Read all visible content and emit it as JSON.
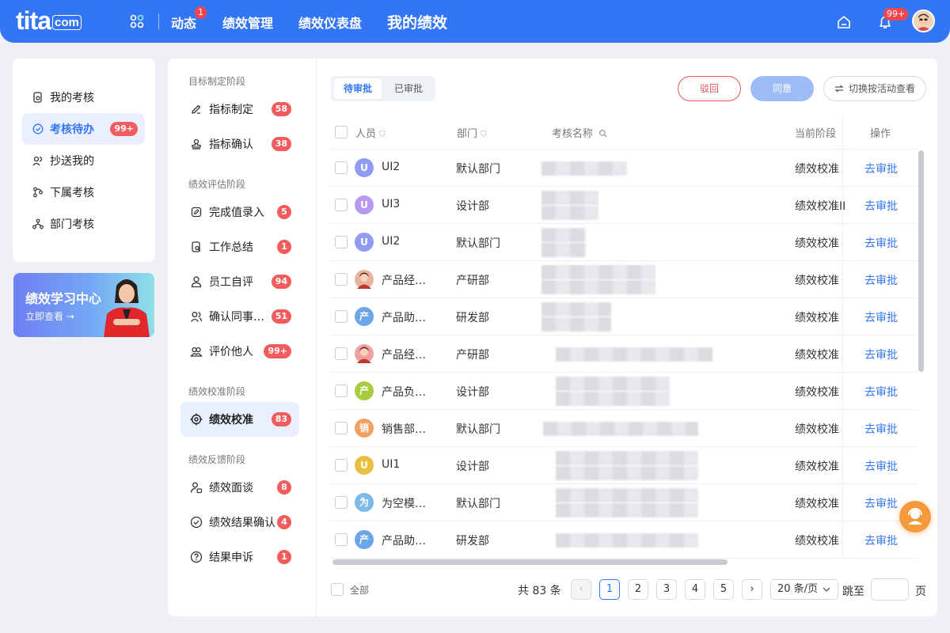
{
  "topbar": {
    "logo_main": "tita",
    "logo_suffix": "com",
    "nav": [
      "动态",
      "绩效管理",
      "绩效仪表盘",
      "我的绩效"
    ],
    "dynamic_badge": "1",
    "notify_badge": "99+"
  },
  "left_menu": [
    {
      "label": "我的考核"
    },
    {
      "label": "考核待办",
      "badge": "99+"
    },
    {
      "label": "抄送我的"
    },
    {
      "label": "下属考核"
    },
    {
      "label": "部门考核"
    }
  ],
  "learning": {
    "title": "绩效学习中心",
    "link": "立即查看 →"
  },
  "stages": {
    "s1_title": "目标制定阶段",
    "s1": [
      {
        "label": "指标制定",
        "badge": "58"
      },
      {
        "label": "指标确认",
        "badge": "38"
      }
    ],
    "s2_title": "绩效评估阶段",
    "s2": [
      {
        "label": "完成值录入",
        "badge": "5"
      },
      {
        "label": "工作总结",
        "badge": "1"
      },
      {
        "label": "员工自评",
        "badge": "94"
      },
      {
        "label": "确认同事…",
        "badge": "51"
      },
      {
        "label": "评价他人",
        "badge": "99+"
      }
    ],
    "s3_title": "绩效校准阶段",
    "s3": [
      {
        "label": "绩效校准",
        "badge": "83"
      }
    ],
    "s4_title": "绩效反馈阶段",
    "s4": [
      {
        "label": "绩效面谈",
        "badge": "8"
      },
      {
        "label": "绩效结果确认",
        "badge": "4"
      },
      {
        "label": "结果申诉",
        "badge": "1"
      }
    ]
  },
  "tabs": [
    "待审批",
    "已审批"
  ],
  "actions": {
    "reject": "驳回",
    "approve": "同意",
    "switch": "切换按活动查看"
  },
  "table": {
    "headers": [
      "人员",
      "部门",
      "考核名称",
      "当前阶段",
      "操作"
    ],
    "rows": [
      {
        "avatar": "U",
        "avatar_color": "#8f9cf0",
        "name": "UI2",
        "dept": "默认部门",
        "stage": "绩效校准",
        "op": "去审批"
      },
      {
        "avatar": "U",
        "avatar_color": "#b79af0",
        "name": "UI3",
        "dept": "设计部",
        "stage": "绩效校准II",
        "op": "去审批"
      },
      {
        "avatar": "U",
        "avatar_color": "#8f9cf0",
        "name": "UI2",
        "dept": "默认部门",
        "stage": "绩效校准",
        "op": "去审批"
      },
      {
        "avatar": "",
        "avatar_color": "#e8b2a0",
        "name": "产品经…",
        "dept": "产研部",
        "stage": "绩效校准",
        "op": "去审批"
      },
      {
        "avatar": "产",
        "avatar_color": "#6ca6e8",
        "name": "产品助…",
        "dept": "研发部",
        "stage": "绩效校准",
        "op": "去审批"
      },
      {
        "avatar": "",
        "avatar_color": "#f0a0a0",
        "name": "产品经…",
        "dept": "产研部",
        "stage": "绩效校准",
        "op": "去审批"
      },
      {
        "avatar": "产",
        "avatar_color": "#a8cc3c",
        "name": "产品负…",
        "dept": "设计部",
        "stage": "绩效校准",
        "op": "去审批"
      },
      {
        "avatar": "销",
        "avatar_color": "#f0a060",
        "name": "销售部…",
        "dept": "默认部门",
        "stage": "绩效校准",
        "op": "去审批"
      },
      {
        "avatar": "U",
        "avatar_color": "#e8c040",
        "name": "UI1",
        "dept": "设计部",
        "stage": "绩效校准",
        "op": "去审批"
      },
      {
        "avatar": "为",
        "avatar_color": "#7cb8e8",
        "name": "为空模…",
        "dept": "默认部门",
        "stage": "绩效校准",
        "op": "去审批"
      },
      {
        "avatar": "产",
        "avatar_color": "#6ca6e8",
        "name": "产品助…",
        "dept": "研发部",
        "stage": "绩效校准",
        "op": "去审批"
      }
    ]
  },
  "footer": {
    "select_all": "全部",
    "total": "共 83 条",
    "pages": [
      "1",
      "2",
      "3",
      "4",
      "5"
    ],
    "current_page": "1",
    "page_size": "20 条/页",
    "jump_label": "跳至",
    "page_unit": "页"
  },
  "colors": {
    "primary": "#3376f5",
    "badge": "#f25c5c",
    "reject": "#e85454"
  }
}
